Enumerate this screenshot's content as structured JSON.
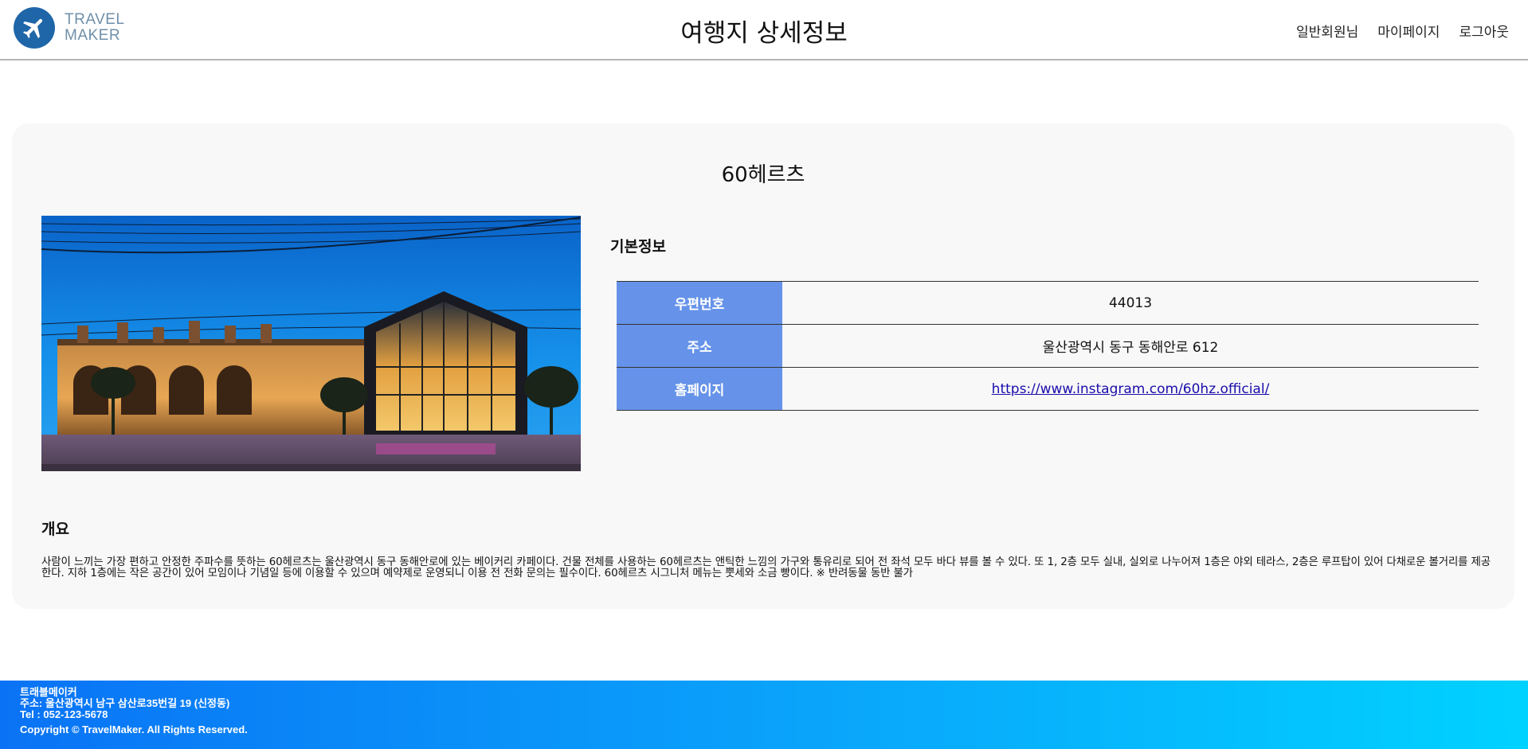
{
  "header": {
    "logo_line1": "TRAVEL",
    "logo_line2": "MAKER",
    "title": "여행지 상세정보",
    "nav": [
      "일반회원님",
      "마이페이지",
      "로그아웃"
    ]
  },
  "place": {
    "name": "60헤르츠",
    "basic_info_title": "기본정보",
    "rows": [
      {
        "label": "우편번호",
        "value": "44013"
      },
      {
        "label": "주소",
        "value": "울산광역시 동구 동해안로 612"
      },
      {
        "label": "홈페이지",
        "value": "https://www.instagram.com/60hz.official/"
      }
    ],
    "overview_title": "개요",
    "overview": "사람이 느끼는 가장 편하고 안정한 주파수를 뜻하는 60헤르츠는 울산광역시 동구 동해안로에 있는 베이커리 카페이다. 건물 전체를 사용하는 60헤르츠는 앤틱한 느낌의 가구와 통유리로 되어 전 좌석 모두 바다 뷰를 볼 수 있다. 또 1, 2층 모두 실내, 실외로 나누어져 1층은 야외 테라스, 2층은 루프탑이 있어 다채로운 볼거리를 제공한다. 지하 1층에는 작은 공간이 있어 모임이나 기념일 등에 이용할 수 있으며 예약제로 운영되니 이용 전 전화 문의는 필수이다. 60헤르츠 시그니처 메뉴는 뿟세와 소금 빵이다. ※ 반려동물 동반 불가"
  },
  "footer": {
    "company": "트래블메이커",
    "address": "주소: 울산광역시 남구 삼산로35번길 19 (신정동)",
    "tel": "Tel : 052-123-5678",
    "copyright": "Copyright © TravelMaker. All Rights Reserved."
  },
  "colors": {
    "logo": "#1f66a8",
    "table_header": "#6693e9",
    "footer_start": "#0a73f5",
    "footer_end": "#00d2ff"
  }
}
